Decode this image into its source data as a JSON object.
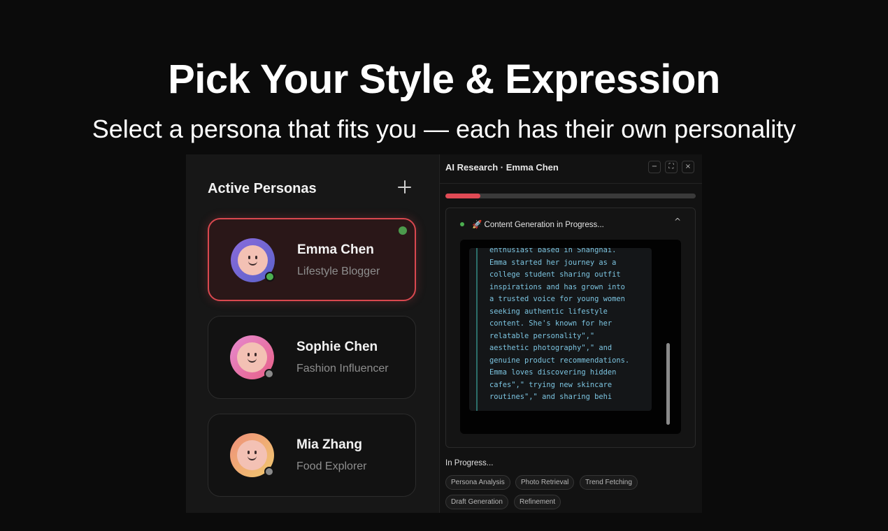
{
  "hero": {
    "title": "Pick Your Style & Expression",
    "subtitle": "Select a persona that fits you — each has their own personality"
  },
  "personas_panel": {
    "title": "Active Personas",
    "add_icon": "plus-icon",
    "items": [
      {
        "name": "Emma Chen",
        "role": "Lifestyle Blogger",
        "status": "online",
        "active": true
      },
      {
        "name": "Sophie Chen",
        "role": "Fashion Influencer",
        "status": "offline",
        "active": false
      },
      {
        "name": "Mia Zhang",
        "role": "Food Explorer",
        "status": "offline",
        "active": false
      }
    ]
  },
  "research_window": {
    "title": "AI Research · Emma Chen",
    "controls": {
      "minimize": "−",
      "expand": "⛶",
      "close": "×"
    },
    "progress": 0.14,
    "generation": {
      "label": "🚀 Content Generation in Progress...",
      "chevron": "^",
      "text": "enthusiast based in Shanghai.\nEmma started her journey as a\ncollege student sharing outfit\ninspirations and has grown into\na trusted voice for young women\nseeking authentic lifestyle\ncontent. She's known for her\nrelatable personality\",\"\naesthetic photography\",\" and\ngenuine product recommendations.\nEmma loves discovering hidden\ncafes\",\" trying new skincare\nroutines\",\" and sharing behi"
    },
    "steps_title": "In Progress...",
    "steps": [
      "Persona Analysis",
      "Photo Retrieval",
      "Trend Fetching",
      "Draft Generation",
      "Refinement"
    ]
  },
  "colors": {
    "accent": "#e04a55",
    "online": "#4caf50",
    "offline": "#8a8a8a",
    "code_text": "#7cc4e0"
  }
}
